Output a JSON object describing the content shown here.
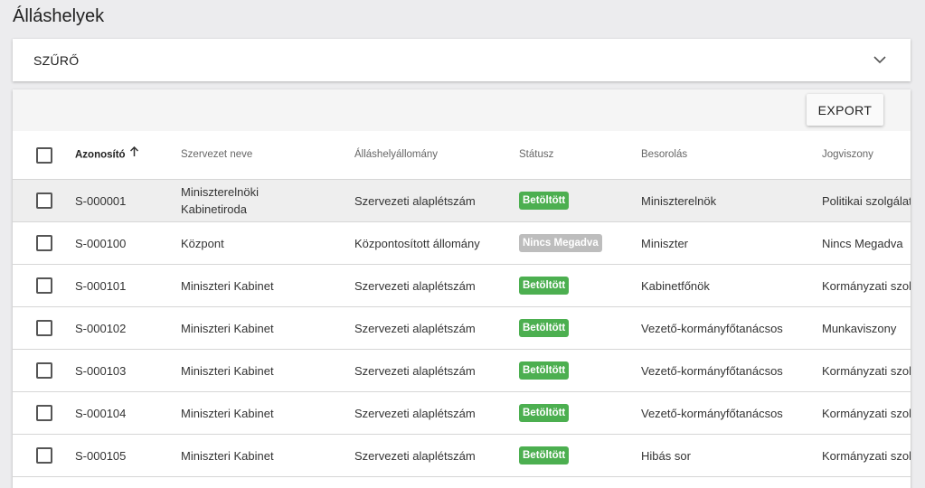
{
  "page": {
    "title": "Álláshelyek"
  },
  "filter": {
    "label": "SZŰRŐ",
    "icon": "chevron-down-icon"
  },
  "toolbar": {
    "export_label": "EXPORT"
  },
  "table": {
    "headers": {
      "id": "Azonosító",
      "org": "Szervezet neve",
      "pool": "Álláshelyállomány",
      "status": "Státusz",
      "class": "Besorolás",
      "legal": "Jogviszony"
    },
    "sort": {
      "column": "id",
      "direction": "ascending",
      "icon": "arrow-up-icon"
    },
    "status_colors": {
      "Betöltött": "#4caf50",
      "Nincs Megadva": "#bdbdbd"
    },
    "rows": [
      {
        "id": "S-000001",
        "org_line1": "Miniszterelnöki",
        "org_line2": "Kabinetiroda",
        "pool": "Szervezeti alaplétszám",
        "status": "Betöltött",
        "class": "Miniszterelnök",
        "legal": "Politikai szolgálat"
      },
      {
        "id": "S-000100",
        "org_line1": "Központ",
        "org_line2": "",
        "pool": "Központosított állomány",
        "status": "Nincs Megadva",
        "class": "Miniszter",
        "legal": "Nincs Megadva"
      },
      {
        "id": "S-000101",
        "org_line1": "Miniszteri Kabinet",
        "org_line2": "",
        "pool": "Szervezeti alaplétszám",
        "status": "Betöltött",
        "class": "Kabinetfőnök",
        "legal": "Kormányzati szolg"
      },
      {
        "id": "S-000102",
        "org_line1": "Miniszteri Kabinet",
        "org_line2": "",
        "pool": "Szervezeti alaplétszám",
        "status": "Betöltött",
        "class": "Vezető-kormányfőtanácsos",
        "legal": "Munkaviszony"
      },
      {
        "id": "S-000103",
        "org_line1": "Miniszteri Kabinet",
        "org_line2": "",
        "pool": "Szervezeti alaplétszám",
        "status": "Betöltött",
        "class": "Vezető-kormányfőtanácsos",
        "legal": "Kormányzati szolg"
      },
      {
        "id": "S-000104",
        "org_line1": "Miniszteri Kabinet",
        "org_line2": "",
        "pool": "Szervezeti alaplétszám",
        "status": "Betöltött",
        "class": "Vezető-kormányfőtanácsos",
        "legal": "Kormányzati szolg"
      },
      {
        "id": "S-000105",
        "org_line1": "Miniszteri Kabinet",
        "org_line2": "",
        "pool": "Szervezeti alaplétszám",
        "status": "Betöltött",
        "class": "Hibás sor",
        "legal": "Kormányzati szolg"
      }
    ]
  }
}
